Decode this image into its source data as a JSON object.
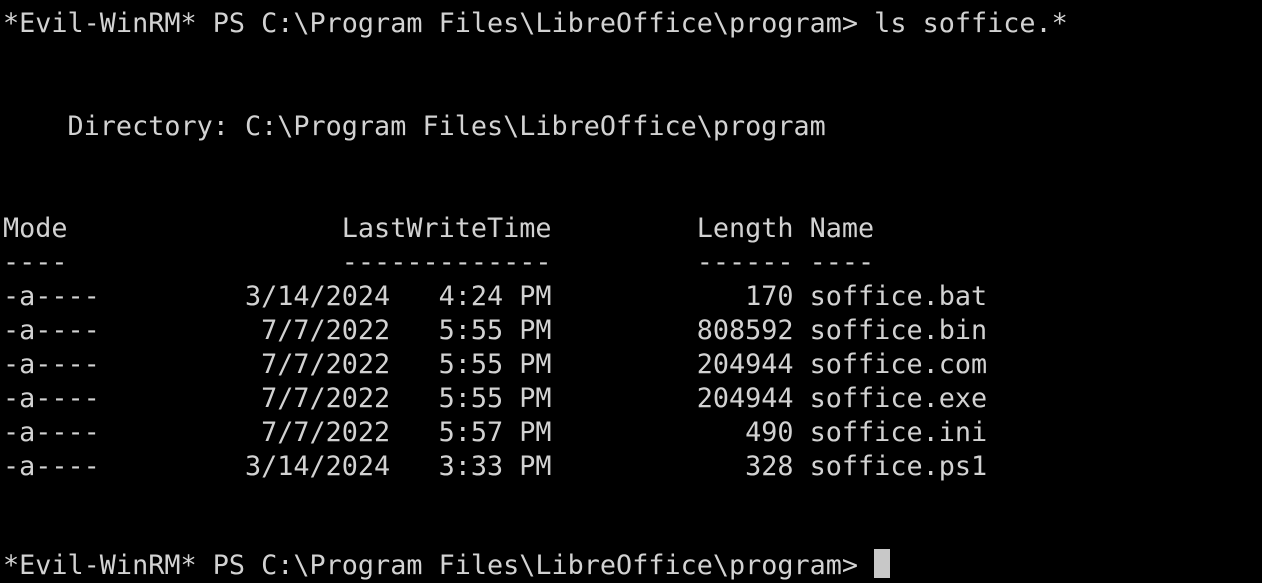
{
  "terminal": {
    "prompt1": "*Evil-WinRM* PS C:\\Program Files\\LibreOffice\\program> ls soffice.*",
    "directory_line": "    Directory: C:\\Program Files\\LibreOffice\\program",
    "header": "Mode                 LastWriteTime         Length Name",
    "separator": "----                 -------------         ------ ----",
    "rows": [
      "-a----         3/14/2024   4:24 PM            170 soffice.bat",
      "-a----          7/7/2022   5:55 PM         808592 soffice.bin",
      "-a----          7/7/2022   5:55 PM         204944 soffice.com",
      "-a----          7/7/2022   5:55 PM         204944 soffice.exe",
      "-a----          7/7/2022   5:57 PM            490 soffice.ini",
      "-a----         3/14/2024   3:33 PM            328 soffice.ps1"
    ],
    "prompt2": "*Evil-WinRM* PS C:\\Program Files\\LibreOffice\\program> "
  },
  "colors": {
    "background": "#000000",
    "foreground": "#d2d2d2",
    "cursor": "#c8c8c8"
  }
}
